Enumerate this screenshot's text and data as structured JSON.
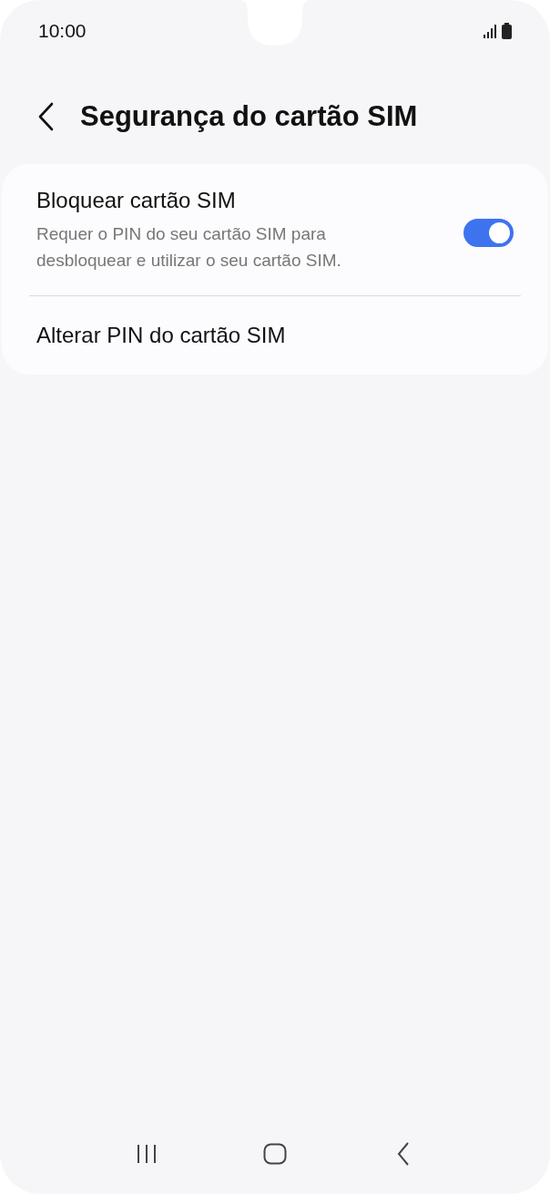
{
  "status_bar": {
    "time": "10:00"
  },
  "header": {
    "title": "Segurança do cartão SIM"
  },
  "settings": [
    {
      "kind": "toggle",
      "title": "Bloquear cartão SIM",
      "description": "Requer o PIN do seu cartão SIM para desbloquear e utilizar o seu cartão SIM.",
      "on": true
    },
    {
      "kind": "link",
      "title": "Alterar PIN do cartão SIM"
    }
  ]
}
